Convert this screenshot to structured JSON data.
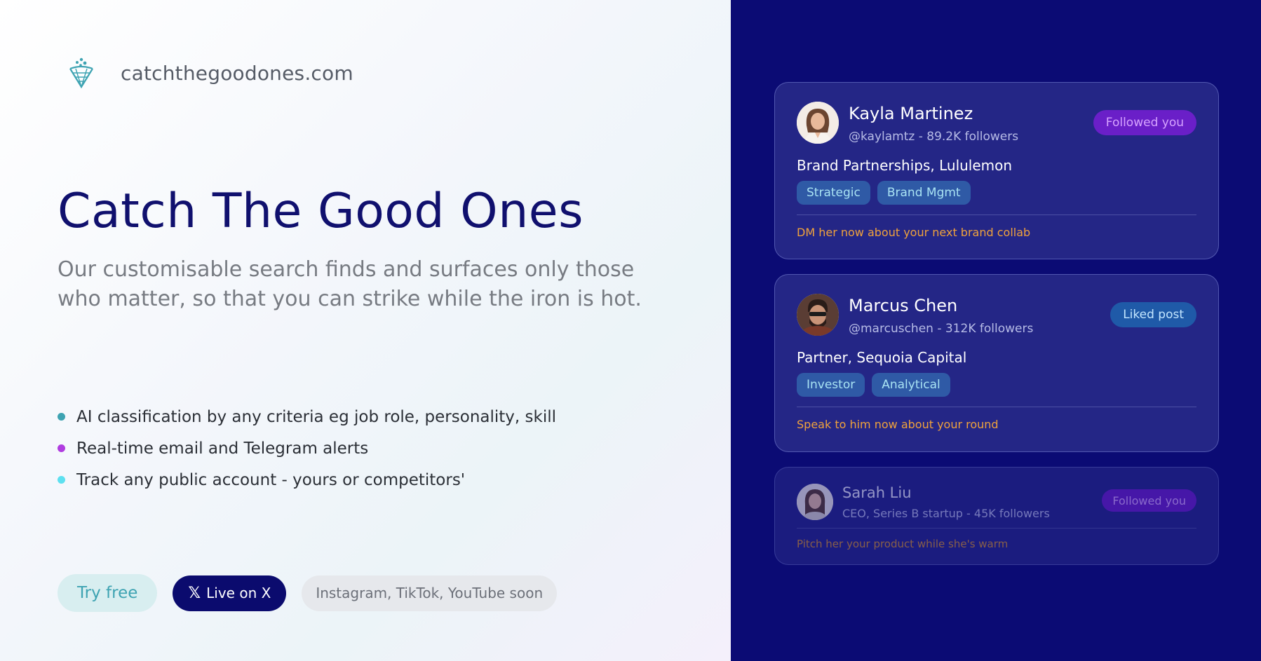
{
  "brand": {
    "name": "catchthegoodones.com",
    "logo_icon": "net-catcher-icon"
  },
  "hero": {
    "title": "Catch The Good Ones",
    "subtitle": "Our customisable search finds and surfaces only those who matter,  so that you can strike while the iron is hot."
  },
  "features": [
    {
      "text": "AI classification by any criteria eg job role, personality, skill",
      "dot_color": "#3ea3b2"
    },
    {
      "text": "Real-time email and Telegram alerts",
      "dot_color": "#b03de0"
    },
    {
      "text": "Track any public account - yours or competitors'",
      "dot_color": "#5de0f0"
    }
  ],
  "cta": {
    "try_label": "Try free",
    "x_label": "Live on X",
    "x_icon": "x-logo-icon",
    "soon_label": "Instagram, TikTok, YouTube soon"
  },
  "cards": [
    {
      "name": "Kayla Martinez",
      "handle": "@kaylamtz - 89.2K followers",
      "badge": "Followed you",
      "role": "Brand Partnerships, Lululemon",
      "tags": [
        "Strategic",
        "Brand Mgmt"
      ],
      "note": "DM her now about your next brand collab",
      "avatar_icon": "woman-avatar-icon"
    },
    {
      "name": "Marcus Chen",
      "handle": "@marcuschen - 312K followers",
      "badge": "Liked post",
      "role": "Partner,  Sequoia Capital",
      "tags": [
        "Investor",
        "Analytical"
      ],
      "note": "Speak to him now about your round",
      "avatar_icon": "man-avatar-icon"
    },
    {
      "name": "Sarah Liu",
      "handle": "CEO, Series B startup - 45K followers",
      "badge": "Followed you",
      "note": "Pitch her your product while she's warm",
      "avatar_icon": "woman-avatar-icon"
    }
  ],
  "colors": {
    "panel_bg": "#0b0b74",
    "title": "#10106e",
    "note": "#f0a23c",
    "badge_followed": "#6a1fc8",
    "badge_liked": "#1f5aa8"
  }
}
